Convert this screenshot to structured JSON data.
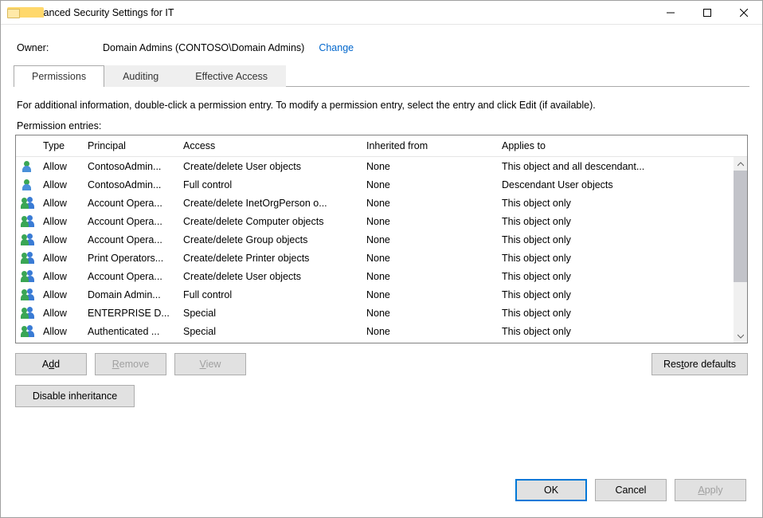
{
  "window": {
    "title": "Advanced Security Settings for IT"
  },
  "owner": {
    "label": "Owner:",
    "value": "Domain Admins (CONTOSO\\Domain Admins)",
    "change_label": "Change"
  },
  "tabs": {
    "permissions": "Permissions",
    "auditing": "Auditing",
    "effective": "Effective Access"
  },
  "info_text": "For additional information, double-click a permission entry. To modify a permission entry, select the entry and click Edit (if available).",
  "entries_label": "Permission entries:",
  "columns": {
    "type": "Type",
    "principal": "Principal",
    "access": "Access",
    "inherited": "Inherited from",
    "applies": "Applies to"
  },
  "entries": [
    {
      "icon": "person",
      "type": "Allow",
      "principal": "ContosoAdmin...",
      "access": "Create/delete User objects",
      "inherited": "None",
      "applies": "This object and all descendant..."
    },
    {
      "icon": "person",
      "type": "Allow",
      "principal": "ContosoAdmin...",
      "access": "Full control",
      "inherited": "None",
      "applies": "Descendant User objects"
    },
    {
      "icon": "users",
      "type": "Allow",
      "principal": "Account Opera...",
      "access": "Create/delete InetOrgPerson o...",
      "inherited": "None",
      "applies": "This object only"
    },
    {
      "icon": "users",
      "type": "Allow",
      "principal": "Account Opera...",
      "access": "Create/delete Computer objects",
      "inherited": "None",
      "applies": "This object only"
    },
    {
      "icon": "users",
      "type": "Allow",
      "principal": "Account Opera...",
      "access": "Create/delete Group objects",
      "inherited": "None",
      "applies": "This object only"
    },
    {
      "icon": "users",
      "type": "Allow",
      "principal": "Print Operators...",
      "access": "Create/delete Printer objects",
      "inherited": "None",
      "applies": "This object only"
    },
    {
      "icon": "users",
      "type": "Allow",
      "principal": "Account Opera...",
      "access": "Create/delete User objects",
      "inherited": "None",
      "applies": "This object only"
    },
    {
      "icon": "users",
      "type": "Allow",
      "principal": "Domain Admin...",
      "access": "Full control",
      "inherited": "None",
      "applies": "This object only"
    },
    {
      "icon": "users",
      "type": "Allow",
      "principal": "ENTERPRISE D...",
      "access": "Special",
      "inherited": "None",
      "applies": "This object only"
    },
    {
      "icon": "users",
      "type": "Allow",
      "principal": "Authenticated ...",
      "access": "Special",
      "inherited": "None",
      "applies": "This object only"
    }
  ],
  "buttons": {
    "add": "Add",
    "remove": "Remove",
    "view": "View",
    "restore": "Restore defaults",
    "disable_inheritance": "Disable inheritance",
    "ok": "OK",
    "cancel": "Cancel",
    "apply": "Apply"
  }
}
